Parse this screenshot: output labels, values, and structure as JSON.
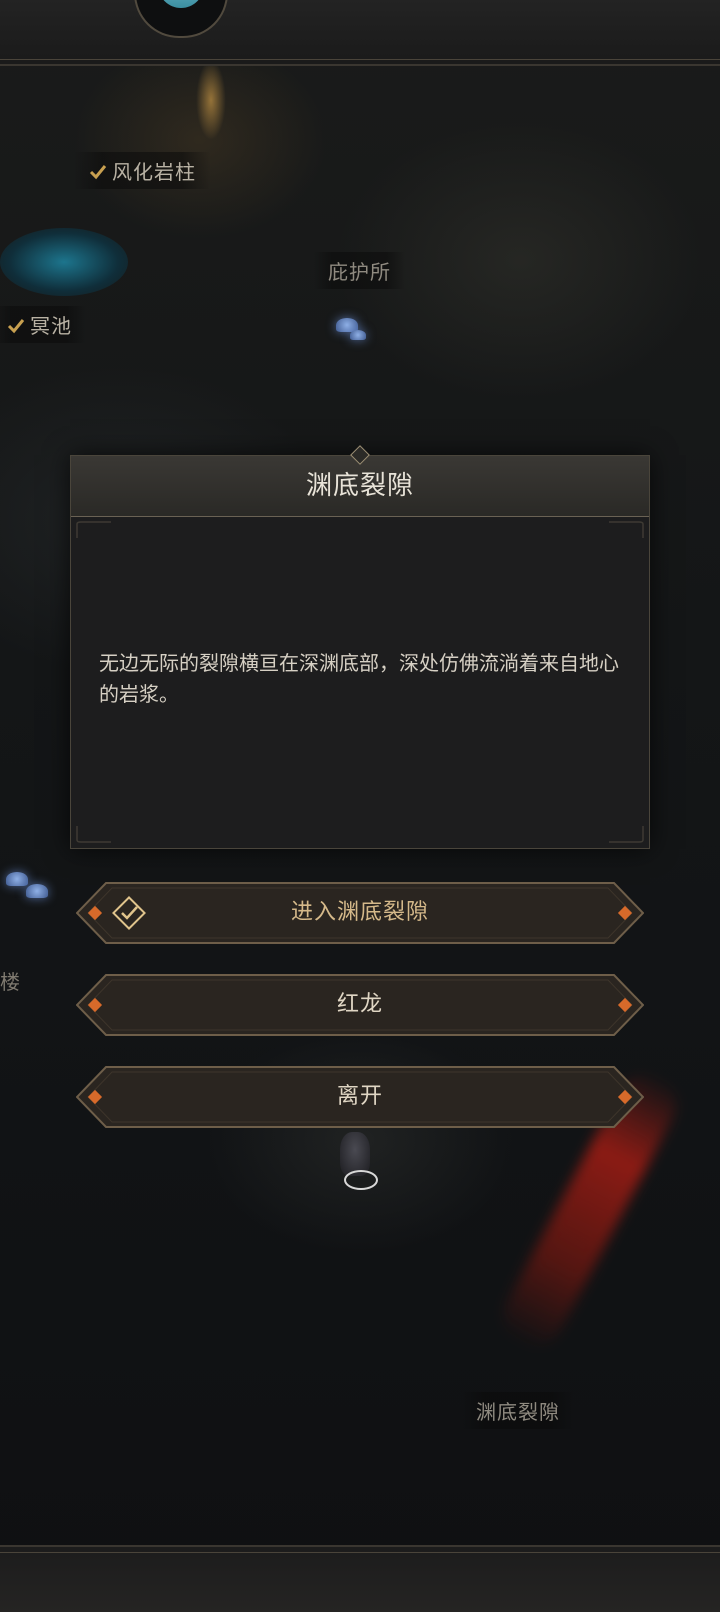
{
  "map": {
    "labels": {
      "weathered_pillar": "风化岩柱",
      "shelter": "庇护所",
      "netherpool": "冥池",
      "abyss_rift": "渊底裂隙",
      "left_partial": "楼"
    }
  },
  "dialog": {
    "title": "渊底裂隙",
    "description": "无边无际的裂隙横亘在深渊底部，深处仿佛流淌着来自地心的岩浆。"
  },
  "options": [
    {
      "label": "进入渊底裂隙",
      "icon": "diamond-check-icon"
    },
    {
      "label": "红龙"
    },
    {
      "label": "离开"
    }
  ],
  "colors": {
    "accent_gold": "#d5b98a",
    "frame_border": "#6a6254",
    "lava": "#b41e14"
  }
}
